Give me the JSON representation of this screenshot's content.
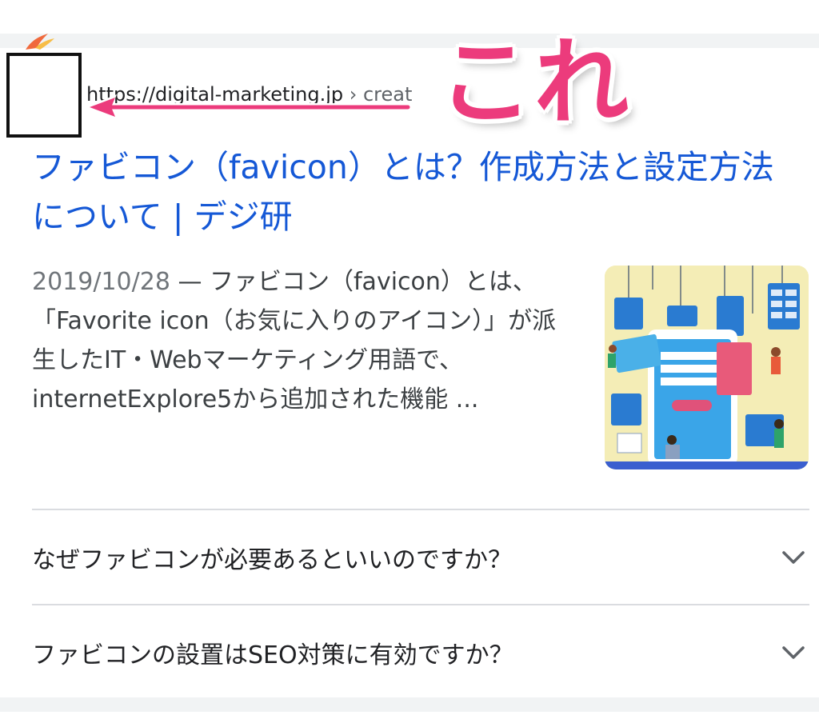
{
  "result": {
    "url": "https://digital-marketing.jp",
    "breadcrumb": "› creat",
    "title": "ファビコン（favicon）とは？作成方法と設定方法について | デジ研",
    "date": "2019/10/28",
    "snippet": " — ファビコン（favicon）とは、「Favorite icon（お気に入りのアイコン）」が派生したIT・Webマーケティング用語で、internetExplore5から追加された機能 ..."
  },
  "annotation": {
    "label": "これ",
    "color": "#ec3b7c"
  },
  "faq": [
    {
      "question": "なぜファビコンが必要あるといいのですか？",
      "icon": "chevron-down-icon"
    },
    {
      "question": "ファビコンの設置はSEO対策に有効ですか？",
      "icon": "chevron-down-icon"
    }
  ],
  "colors": {
    "link": "#1558d6",
    "text": "#3c4043",
    "divider": "#dadce0",
    "accent": "#ec3b7c"
  }
}
